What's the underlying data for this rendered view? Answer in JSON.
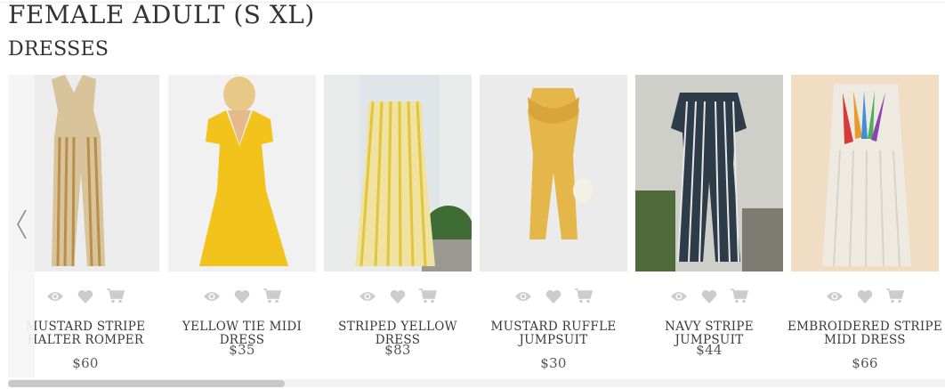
{
  "page_title": "FEMALE ADULT (S XL)",
  "section_title": "DRESSES",
  "products": [
    {
      "name": "MUSTARD STRIPE HALTER ROMPER",
      "price": "$60"
    },
    {
      "name": "YELLOW TIE MIDI DRESS",
      "price": "$35"
    },
    {
      "name": "STRIPED YELLOW DRESS",
      "price": "$83"
    },
    {
      "name": "MUSTARD RUFFLE JUMPSUIT",
      "price": "$30"
    },
    {
      "name": "NAVY STRIPE JUMPSUIT",
      "price": "$44"
    },
    {
      "name": "EMBROIDERED STRIPE MIDI DRESS",
      "price": "$66"
    }
  ],
  "icons": {
    "view": "eye-icon",
    "wishlist": "heart-icon",
    "cart": "cart-icon",
    "prev": "chevron-left-icon"
  },
  "colors": {
    "icon": "#cccccc",
    "text": "#333333",
    "price": "#555555"
  }
}
